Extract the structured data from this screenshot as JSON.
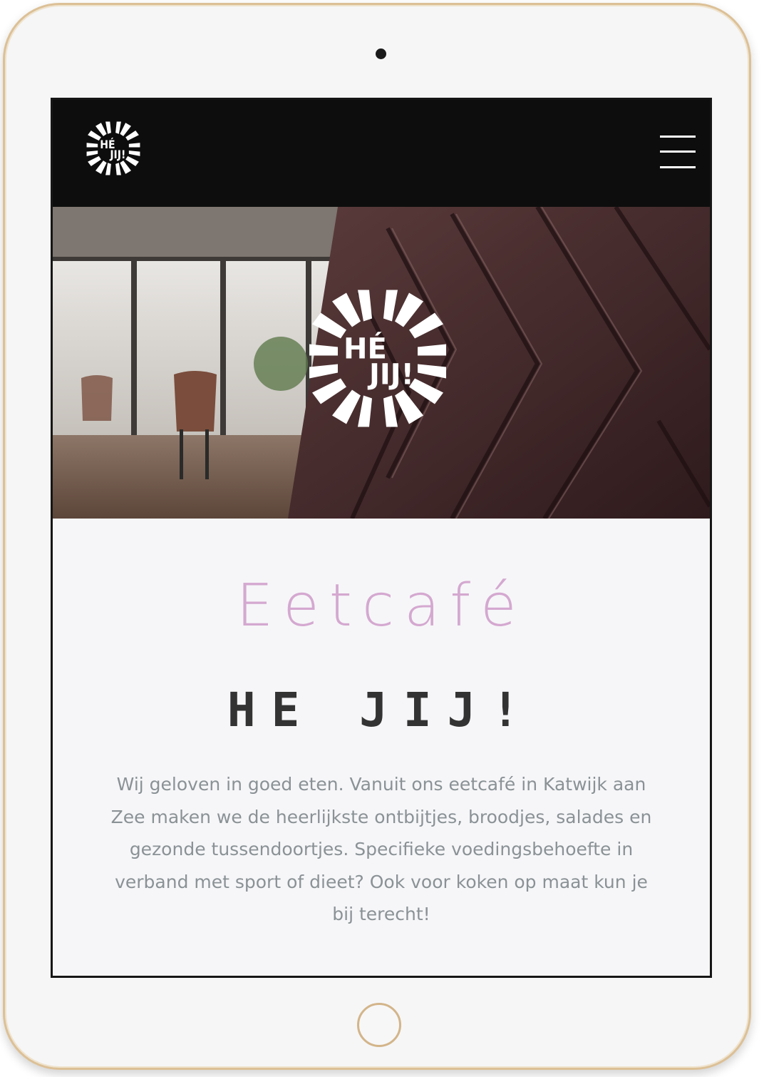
{
  "device": {
    "frame_color": "#dcc096"
  },
  "navbar": {
    "background": "#0d0d0d",
    "logo": {
      "icon": "hejij-sunburst-logo",
      "text_top": "HÉ",
      "text_bottom": "JIJ!"
    },
    "menu_icon": "hamburger-menu-icon"
  },
  "hero": {
    "logo": {
      "icon": "hejij-sunburst-logo",
      "text_top": "HÉ",
      "text_bottom": "JIJ!"
    }
  },
  "content": {
    "eyebrow": "Eetcafé",
    "title": "HE JIJ!",
    "intro": "Wij geloven in goed eten. Vanuit ons eetcafé in Katwijk aan Zee maken we de heerlijkste ontbijtjes, broodjes, salades en gezonde tussendoortjes. Specifieke voedingsbehoefte in verband met sport of dieet? Ook voor koken op maat kun je bij terecht!",
    "eyebrow_color": "#d4a8d0",
    "title_color": "#333333",
    "text_color": "#8a9296"
  }
}
